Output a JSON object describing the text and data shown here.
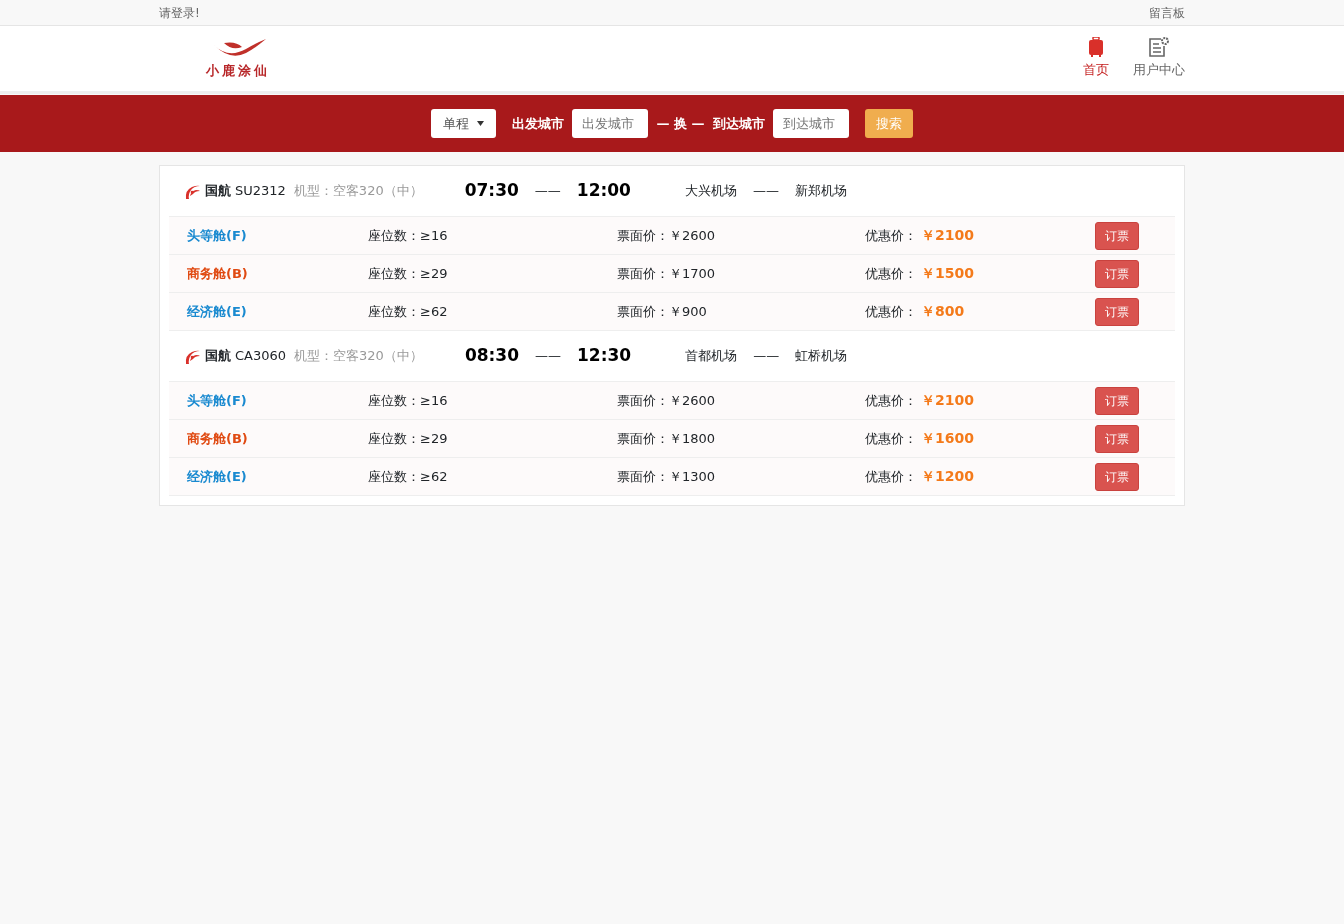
{
  "topbar": {
    "login": "请登录!",
    "guestbook": "留言板"
  },
  "header": {
    "logo_text": "小鹿涂仙",
    "nav": [
      {
        "label": "首页",
        "kind": "suitcase",
        "selected": true
      },
      {
        "label": "用户中心",
        "kind": "document",
        "selected": false
      }
    ]
  },
  "search": {
    "trip_type": "单程",
    "from_label": "出发城市",
    "from_placeholder": "出发城市",
    "swap": "— 换 —",
    "to_label": "到达城市",
    "to_placeholder": "到达城市",
    "button": "搜索"
  },
  "flights": [
    {
      "airline": "国航",
      "number": "SU2312",
      "aircraft": "机型：空客320（中）",
      "depart": "07:30",
      "dash": "——",
      "arrive": "12:00",
      "from": "大兴机场",
      "dash2": "——",
      "to": "新郑机场",
      "cabins": [
        {
          "name": "头等舱(F)",
          "color": "#1a8ad0",
          "seats": "座位数：≥16",
          "fare_label": "票面价：",
          "fare": "￥2600",
          "discount_label": "优惠价：",
          "discount": "￥2100",
          "button": "订票"
        },
        {
          "name": "商务舱(B)",
          "color": "#e04a12",
          "seats": "座位数：≥29",
          "fare_label": "票面价：",
          "fare": "￥1700",
          "discount_label": "优惠价：",
          "discount": "￥1500",
          "button": "订票"
        },
        {
          "name": "经济舱(E)",
          "color": "#1a8ad0",
          "seats": "座位数：≥62",
          "fare_label": "票面价：",
          "fare": "￥900",
          "discount_label": "优惠价：",
          "discount": "￥800",
          "button": "订票"
        }
      ]
    },
    {
      "airline": "国航",
      "number": "CA3060",
      "aircraft": "机型：空客320（中）",
      "depart": "08:30",
      "dash": "——",
      "arrive": "12:30",
      "from": "首都机场",
      "dash2": "——",
      "to": "虹桥机场",
      "cabins": [
        {
          "name": "头等舱(F)",
          "color": "#1a8ad0",
          "seats": "座位数：≥16",
          "fare_label": "票面价：",
          "fare": "￥2600",
          "discount_label": "优惠价：",
          "discount": "￥2100",
          "button": "订票"
        },
        {
          "name": "商务舱(B)",
          "color": "#e04a12",
          "seats": "座位数：≥29",
          "fare_label": "票面价：",
          "fare": "￥1800",
          "discount_label": "优惠价：",
          "discount": "￥1600",
          "button": "订票"
        },
        {
          "name": "经济舱(E)",
          "color": "#1a8ad0",
          "seats": "座位数：≥62",
          "fare_label": "票面价：",
          "fare": "￥1300",
          "discount_label": "优惠价：",
          "discount": "￥1200",
          "button": "订票"
        }
      ]
    }
  ]
}
